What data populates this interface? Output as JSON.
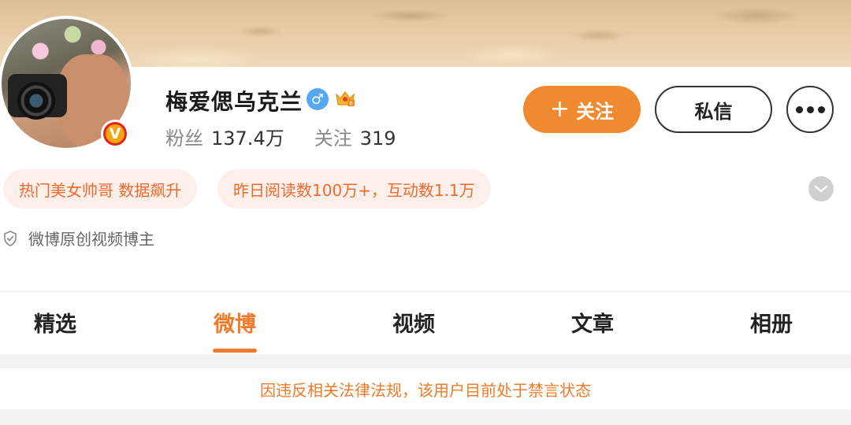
{
  "profile": {
    "name": "梅爱偲乌克兰",
    "gender_icon": "male-icon",
    "followers_label": "粉丝",
    "followers_value": "137.4万",
    "following_label": "关注",
    "following_value": "319",
    "verified_badge": "V"
  },
  "actions": {
    "follow_plus": "+",
    "follow_label": "关注",
    "message_label": "私信"
  },
  "tags": [
    {
      "label": "热门美女帅哥 数据飙升"
    },
    {
      "label": "昨日阅读数100万+，互动数1.1万"
    }
  ],
  "certification": "微博原创视频博主",
  "tabs": [
    {
      "label": "精选"
    },
    {
      "label": "微博"
    },
    {
      "label": "视频"
    },
    {
      "label": "文章"
    },
    {
      "label": "相册"
    }
  ],
  "active_tab": "微博",
  "notice": "因违反相关法律法规，该用户目前处于禁言状态",
  "colors": {
    "accent": "#f08a30",
    "tag_bg": "#fdf0ea",
    "tag_text": "#f06a2d",
    "gender_bg": "#56a8f3"
  }
}
